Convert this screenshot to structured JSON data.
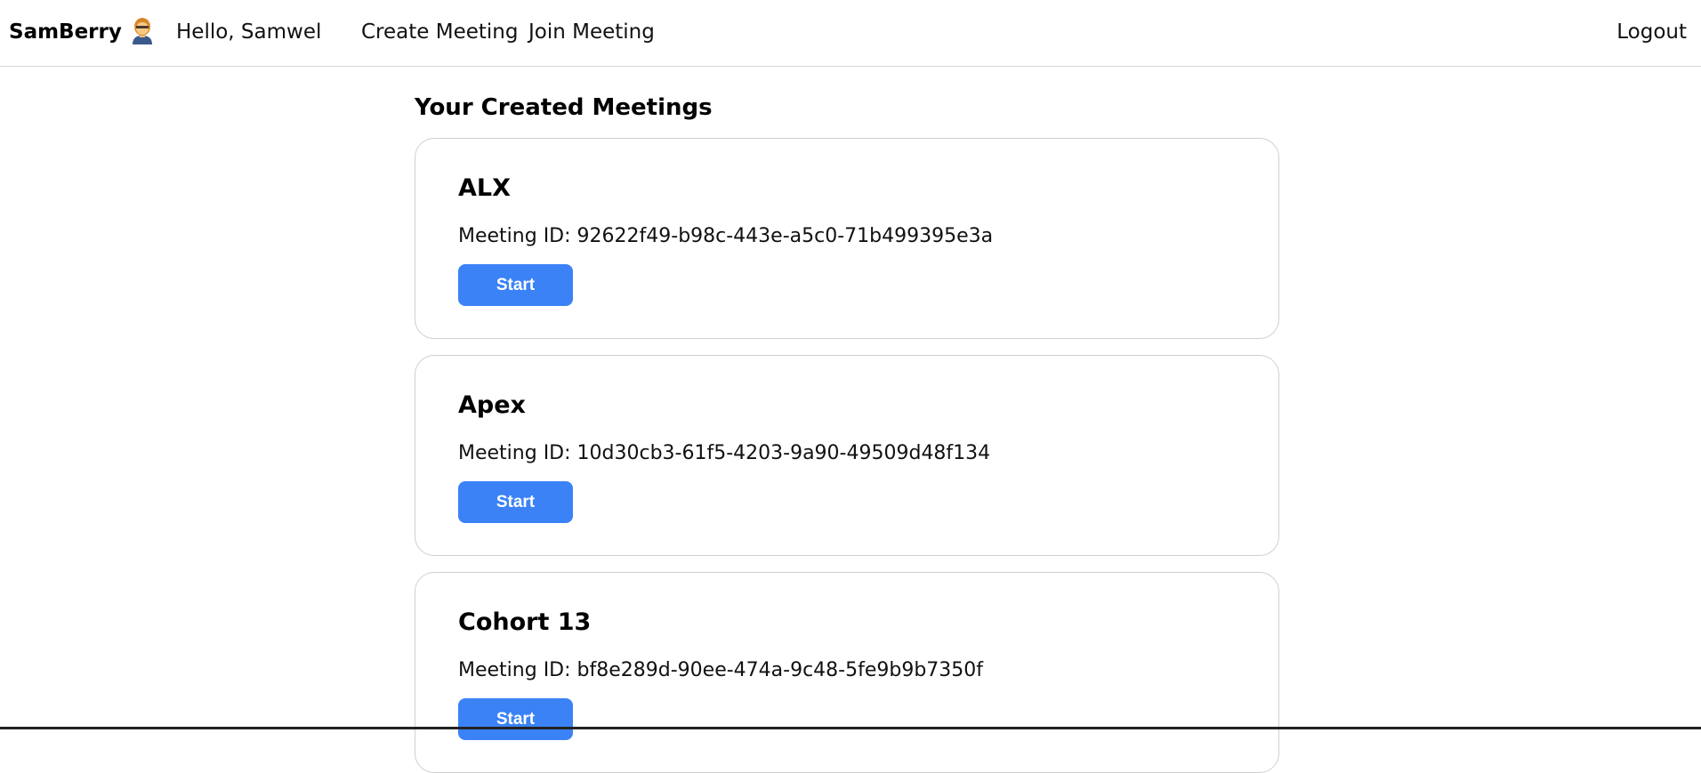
{
  "navbar": {
    "brand": "SamBerry",
    "greeting": "Hello, Samwel",
    "links": {
      "create": "Create Meeting",
      "join": "Join Meeting",
      "logout": "Logout"
    },
    "avatar_icon": "user-avatar-icon"
  },
  "main": {
    "title": "Your Created Meetings",
    "meetings": [
      {
        "name": "ALX",
        "meeting_id": "Meeting ID: 92622f49-b98c-443e-a5c0-71b499395e3a",
        "button": "Start"
      },
      {
        "name": "Apex",
        "meeting_id": "Meeting ID: 10d30cb3-61f5-4203-9a90-49509d48f134",
        "button": "Start"
      },
      {
        "name": "Cohort 13",
        "meeting_id": "Meeting ID: bf8e289d-90ee-474a-9c48-5fe9b9b7350f",
        "button": "Start"
      }
    ]
  },
  "colors": {
    "accent": "#3b82f6",
    "card_border": "#cfcfcf",
    "navbar_border": "#d8d8d8"
  }
}
